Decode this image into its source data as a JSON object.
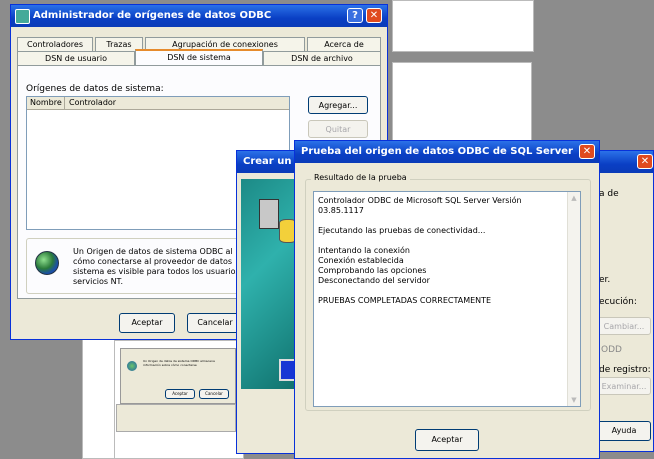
{
  "odbc_admin": {
    "title": "Administrador de orígenes de datos ODBC",
    "help_btn": "?",
    "close_btn": "✕",
    "tabs_row1": [
      "Controladores",
      "Trazas",
      "Agrupación de conexiones",
      "Acerca de"
    ],
    "tabs_row2": [
      "DSN de usuario",
      "DSN de sistema",
      "DSN de archivo"
    ],
    "group_label": "Orígenes de datos de sistema:",
    "col_name": "Nombre",
    "col_driver": "Controlador",
    "add_btn": "Agregar...",
    "remove_btn": "Quitar",
    "info_text": "Un Origen de datos de sistema ODBC al\ncómo conectarse al proveedor de datos\nsistema es visible para todos los usuarios\nservicios NT.",
    "ok_btn": "Aceptar",
    "cancel_btn": "Cancelar"
  },
  "crear_dialog": {
    "title_fragment": "Crear un c"
  },
  "right_dialog": {
    "close_btn": "✕",
    "text1": "a de",
    "text2": "er.",
    "text3": "ecución:",
    "btn1": "Cambiar...",
    "text4": "ODD",
    "text5": "de registro:",
    "btn2": "Examinar...",
    "help_btn": "Ayuda"
  },
  "test_dialog": {
    "title": "Prueba del origen de datos ODBC de SQL Server",
    "close_btn": "✕",
    "group_label": "Resultado de la prueba",
    "result_lines": [
      "Controlador ODBC de Microsoft SQL Server Versión",
      "03.85.1117",
      "",
      "Ejecutando las pruebas de conectividad...",
      "",
      "Intentando la conexión",
      "Conexión establecida",
      "Comprobando las opciones",
      "Desconectando del servidor",
      "",
      "PRUEBAS COMPLETADAS CORRECTAMENTE"
    ],
    "ok_btn": "Aceptar"
  },
  "thumbnail": {
    "text": "Un Origen de datos de sistema ODBC almacena información sobre cómo conectarse",
    "ok_btn": "Aceptar",
    "cancel_btn": "Cancelar"
  },
  "colors": {
    "desktop": "#8c8c8c",
    "title_blue": "#0a3fc4",
    "close_red": "#e04a1f",
    "dialog_face": "#ece9d8"
  }
}
